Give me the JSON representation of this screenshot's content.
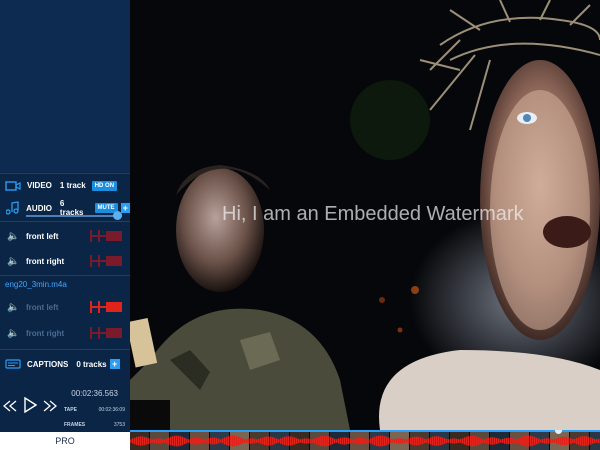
{
  "sidebar": {
    "video": {
      "label": "VIDEO",
      "count": "1 track",
      "badge": "HD ON"
    },
    "audio": {
      "label": "AUDIO",
      "count": "6 tracks",
      "mute": "MUTE",
      "plus": "+",
      "volume": 0.95
    },
    "tracks_a": [
      {
        "name": "front left"
      },
      {
        "name": "front right"
      }
    ],
    "file_name": "eng20_3min.m4a",
    "tracks_b": [
      {
        "name": "front left"
      },
      {
        "name": "front right"
      }
    ],
    "captions": {
      "label": "CAPTIONS",
      "count": "0 tracks",
      "plus": "+"
    },
    "timecode": "00:02:36.563",
    "tape_label": "TAPE",
    "tape_value": "00:02:36:09",
    "frames_label": "FRAMES",
    "frames_value": "3753",
    "pro_label": "PRO"
  },
  "video": {
    "watermark": "Hi, I am an Embedded Watermark"
  },
  "timeline": {
    "position": 0.91
  },
  "colors": {
    "sidebar_bg": "#0b2547",
    "accent": "#2a9df4",
    "track_red": "#e0241b",
    "track_red_dim": "#7a1b2c"
  }
}
